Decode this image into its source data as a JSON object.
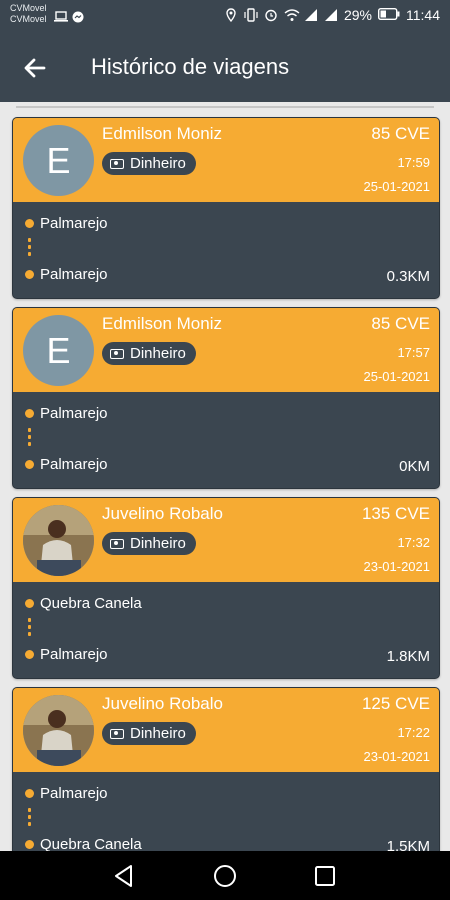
{
  "status_bar": {
    "carrier_1": "CVMovel",
    "carrier_2": "CVMovel",
    "battery": "29%",
    "time": "11:44"
  },
  "app_bar": {
    "title": "Histórico de viagens",
    "back_icon": "arrow-left-icon"
  },
  "trips": [
    {
      "avatar_letter": "E",
      "has_photo": false,
      "name": "Edmilson Moniz",
      "payment": "Dinheiro",
      "price": "85 CVE",
      "time": "17:59",
      "date": "25-01-2021",
      "from": "Palmarejo",
      "to": "Palmarejo",
      "distance": "0.3KM"
    },
    {
      "avatar_letter": "E",
      "has_photo": false,
      "name": "Edmilson Moniz",
      "payment": "Dinheiro",
      "price": "85 CVE",
      "time": "17:57",
      "date": "25-01-2021",
      "from": "Palmarejo",
      "to": "Palmarejo",
      "distance": "0KM"
    },
    {
      "avatar_letter": "",
      "has_photo": true,
      "name": "Juvelino Robalo",
      "payment": "Dinheiro",
      "price": "135 CVE",
      "time": "17:32",
      "date": "23-01-2021",
      "from": "Quebra Canela",
      "to": "Palmarejo",
      "distance": "1.8KM"
    },
    {
      "avatar_letter": "",
      "has_photo": true,
      "name": "Juvelino Robalo",
      "payment": "Dinheiro",
      "price": "125 CVE",
      "time": "17:22",
      "date": "23-01-2021",
      "from": "Palmarejo",
      "to": "Quebra Canela",
      "distance": "1.5KM"
    }
  ],
  "colors": {
    "primary_dark": "#3b4650",
    "accent_orange": "#f6ab33",
    "background": "#e9e9e9"
  },
  "nav_bar": {
    "icons": [
      "back-triangle-icon",
      "home-circle-icon",
      "recents-square-icon"
    ]
  }
}
